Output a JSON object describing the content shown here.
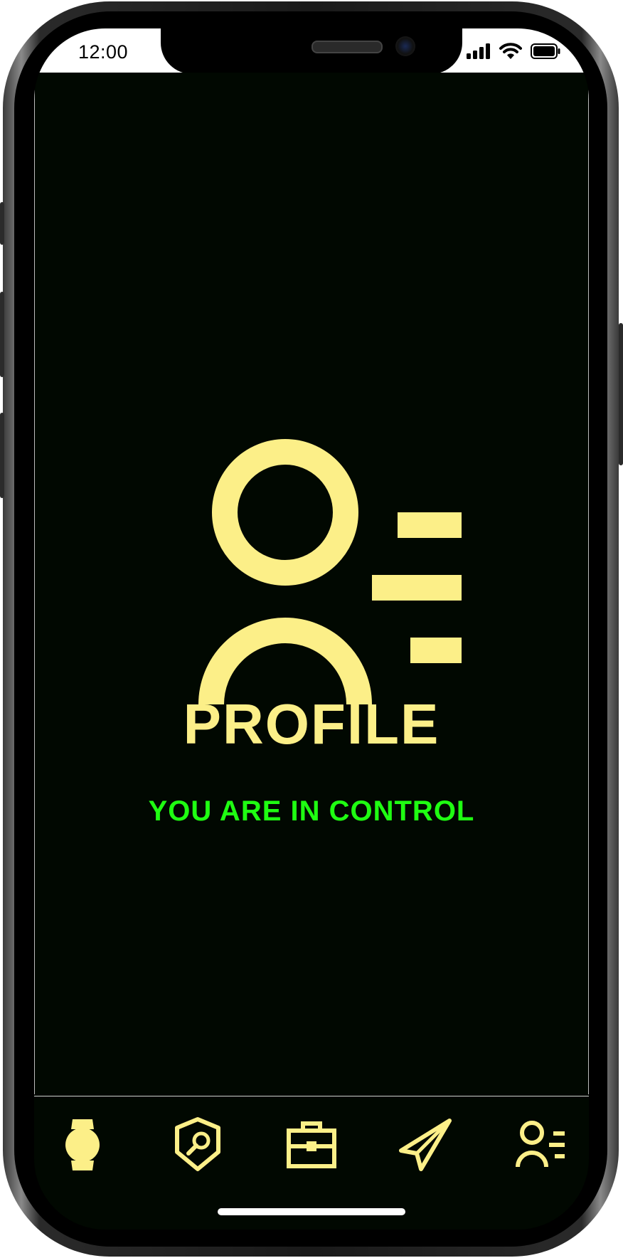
{
  "status_bar": {
    "time": "12:00",
    "icons": [
      "signal-icon",
      "wifi-icon",
      "battery-icon"
    ]
  },
  "profile": {
    "title": "PROFILE",
    "subtitle": "YOU ARE IN CONTROL",
    "icon": "profile-list-icon"
  },
  "tab_bar": {
    "items": [
      {
        "icon": "watch-icon"
      },
      {
        "icon": "shield-search-icon"
      },
      {
        "icon": "briefcase-icon"
      },
      {
        "icon": "paper-plane-icon"
      },
      {
        "icon": "profile-list-icon"
      }
    ]
  },
  "colors": {
    "background": "#010801",
    "accent_yellow": "#fcef88",
    "accent_green": "#1fff12"
  }
}
